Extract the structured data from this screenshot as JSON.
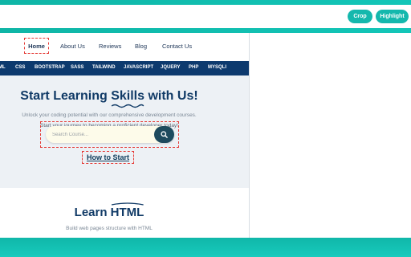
{
  "toolbar": {
    "crop_label": "Crop",
    "highlight_label": "Highlight"
  },
  "nav": {
    "items": [
      "Home",
      "About Us",
      "Reviews",
      "Blog",
      "Contact Us"
    ]
  },
  "techbar": {
    "items": [
      "ML",
      "CSS",
      "BOOTSTRAP",
      "SASS",
      "TAILWIND",
      "JAVASCRIPT",
      "JQUERY",
      "PHP",
      "MYSQLI"
    ]
  },
  "hero": {
    "title_prefix": "Start Learning ",
    "title_highlight": "Skills",
    "title_suffix": " with Us!",
    "subtitle1": "Unlock your coding potential with our comprehensive development courses.",
    "subtitle2": "Start your journey to becoming a proficient developer today!",
    "search_placeholder": "Search Course...",
    "cta": "How to Start"
  },
  "learn": {
    "title_prefix": "Learn ",
    "title_highlight": "HTML",
    "subtitle": "Build web pages structure with HTML"
  },
  "colors": {
    "accent_teal": "#14b8ad",
    "navy": "#0d3a6e",
    "annotation_red": "#e53935"
  }
}
